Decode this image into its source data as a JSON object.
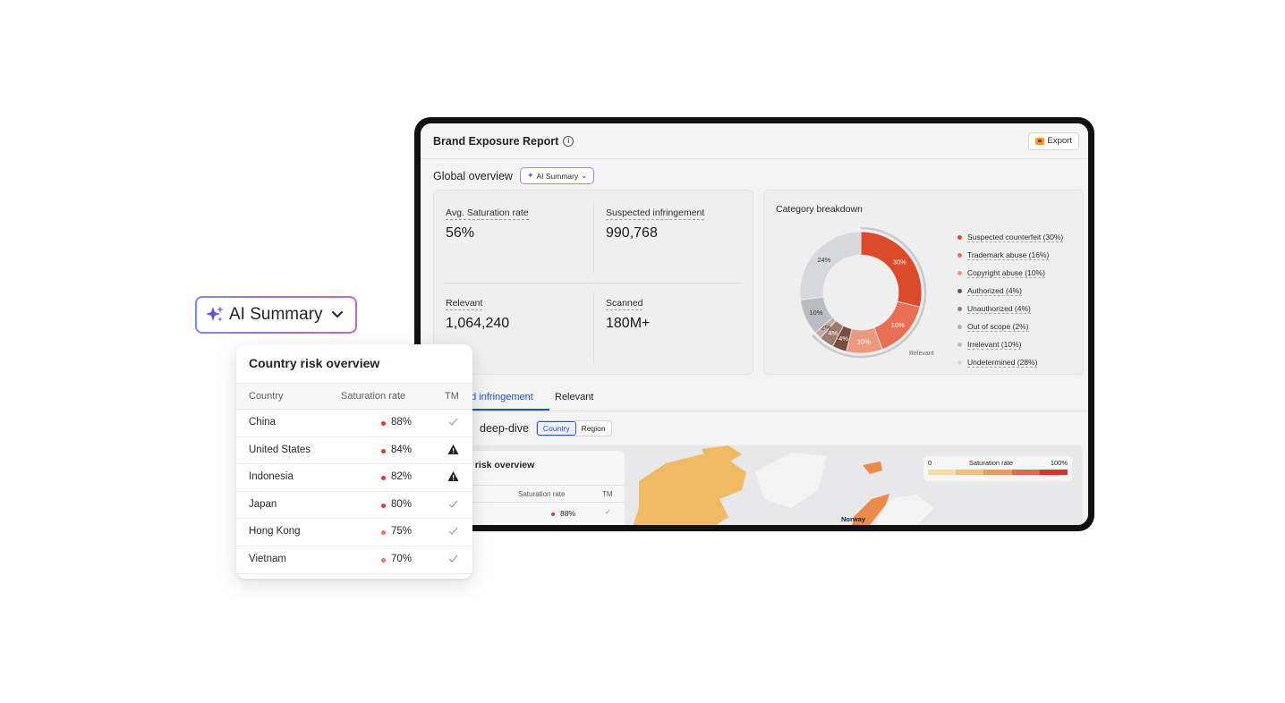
{
  "report": {
    "title": "Brand Exposure Report",
    "info_icon": "i",
    "export_label": "Export",
    "global_title": "Global overview",
    "ai_summary_label": "AI Summary"
  },
  "stats": [
    {
      "label": "Avg. Saturation rate",
      "value": "56%"
    },
    {
      "label": "Suspected infringement",
      "value": "990,768"
    },
    {
      "label": "Relevant",
      "value": "1,064,240"
    },
    {
      "label": "Scanned",
      "value": "180M+"
    }
  ],
  "category": {
    "title": "Category breakdown",
    "relevant_label": "Relevant",
    "slices": [
      {
        "label": "Suspected counterfeit (30%)",
        "value": 30,
        "display": "30%",
        "color": "#dc4a2c"
      },
      {
        "label": "Trademark abuse (16%)",
        "value": 16,
        "display": "16%",
        "color": "#e86f54"
      },
      {
        "label": "Copyright abuse (10%)",
        "value": 10,
        "display": "10%",
        "color": "#eb9a80"
      },
      {
        "label": "Authorized (4%)",
        "value": 4,
        "display": "4%",
        "color": "#7a4e41"
      },
      {
        "label": "Unauthorized (4%)",
        "value": 4,
        "display": "4%",
        "color": "#9d7a6e"
      },
      {
        "label": "Out of scope (2%)",
        "value": 2,
        "display": "2%",
        "color": "#c2aaa2"
      },
      {
        "label": "Irrelevant (10%)",
        "value": 10,
        "display": "10%",
        "color": "#b9bcc2"
      },
      {
        "label": "Undetermined (28%)",
        "value": 28,
        "display": "24%",
        "color": "#d6d8dc"
      }
    ]
  },
  "tabs": [
    {
      "label": "ed infringement",
      "active": true
    },
    {
      "label": "Relevant",
      "active": false
    }
  ],
  "deep_dive": {
    "title": "deep-dive",
    "segments": [
      {
        "label": "Country",
        "active": true
      },
      {
        "label": "Region",
        "active": false
      }
    ]
  },
  "map": {
    "scale_min": "0",
    "scale_label": "Saturation rate",
    "scale_max": "100%",
    "scale_colors": [
      "#f6dca8",
      "#f2c077",
      "#ec9d5a",
      "#e06b4c",
      "#d3382a"
    ],
    "country_label": "Norway"
  },
  "mini_table": {
    "title": "y risk overview",
    "columns": [
      "Saturation rate",
      "TM"
    ],
    "first_value": "88%"
  },
  "floating_pill": {
    "label": "AI Summary"
  },
  "risk_card": {
    "title": "Country risk overview",
    "columns": [
      "Country",
      "Saturation rate",
      "TM"
    ],
    "rows": [
      {
        "country": "China",
        "rate": "88%",
        "dot": "#e03a2a",
        "tm": "check"
      },
      {
        "country": "United States",
        "rate": "84%",
        "dot": "#e03a2a",
        "tm": "warning"
      },
      {
        "country": "Indonesia",
        "rate": "82%",
        "dot": "#e03a2a",
        "tm": "warning"
      },
      {
        "country": "Japan",
        "rate": "80%",
        "dot": "#e03a2a",
        "tm": "check"
      },
      {
        "country": "Hong Kong",
        "rate": "75%",
        "dot": "#ec7a4f",
        "tm": "check"
      },
      {
        "country": "Vietnam",
        "rate": "70%",
        "dot": "#ec7a4f",
        "tm": "check"
      }
    ]
  }
}
